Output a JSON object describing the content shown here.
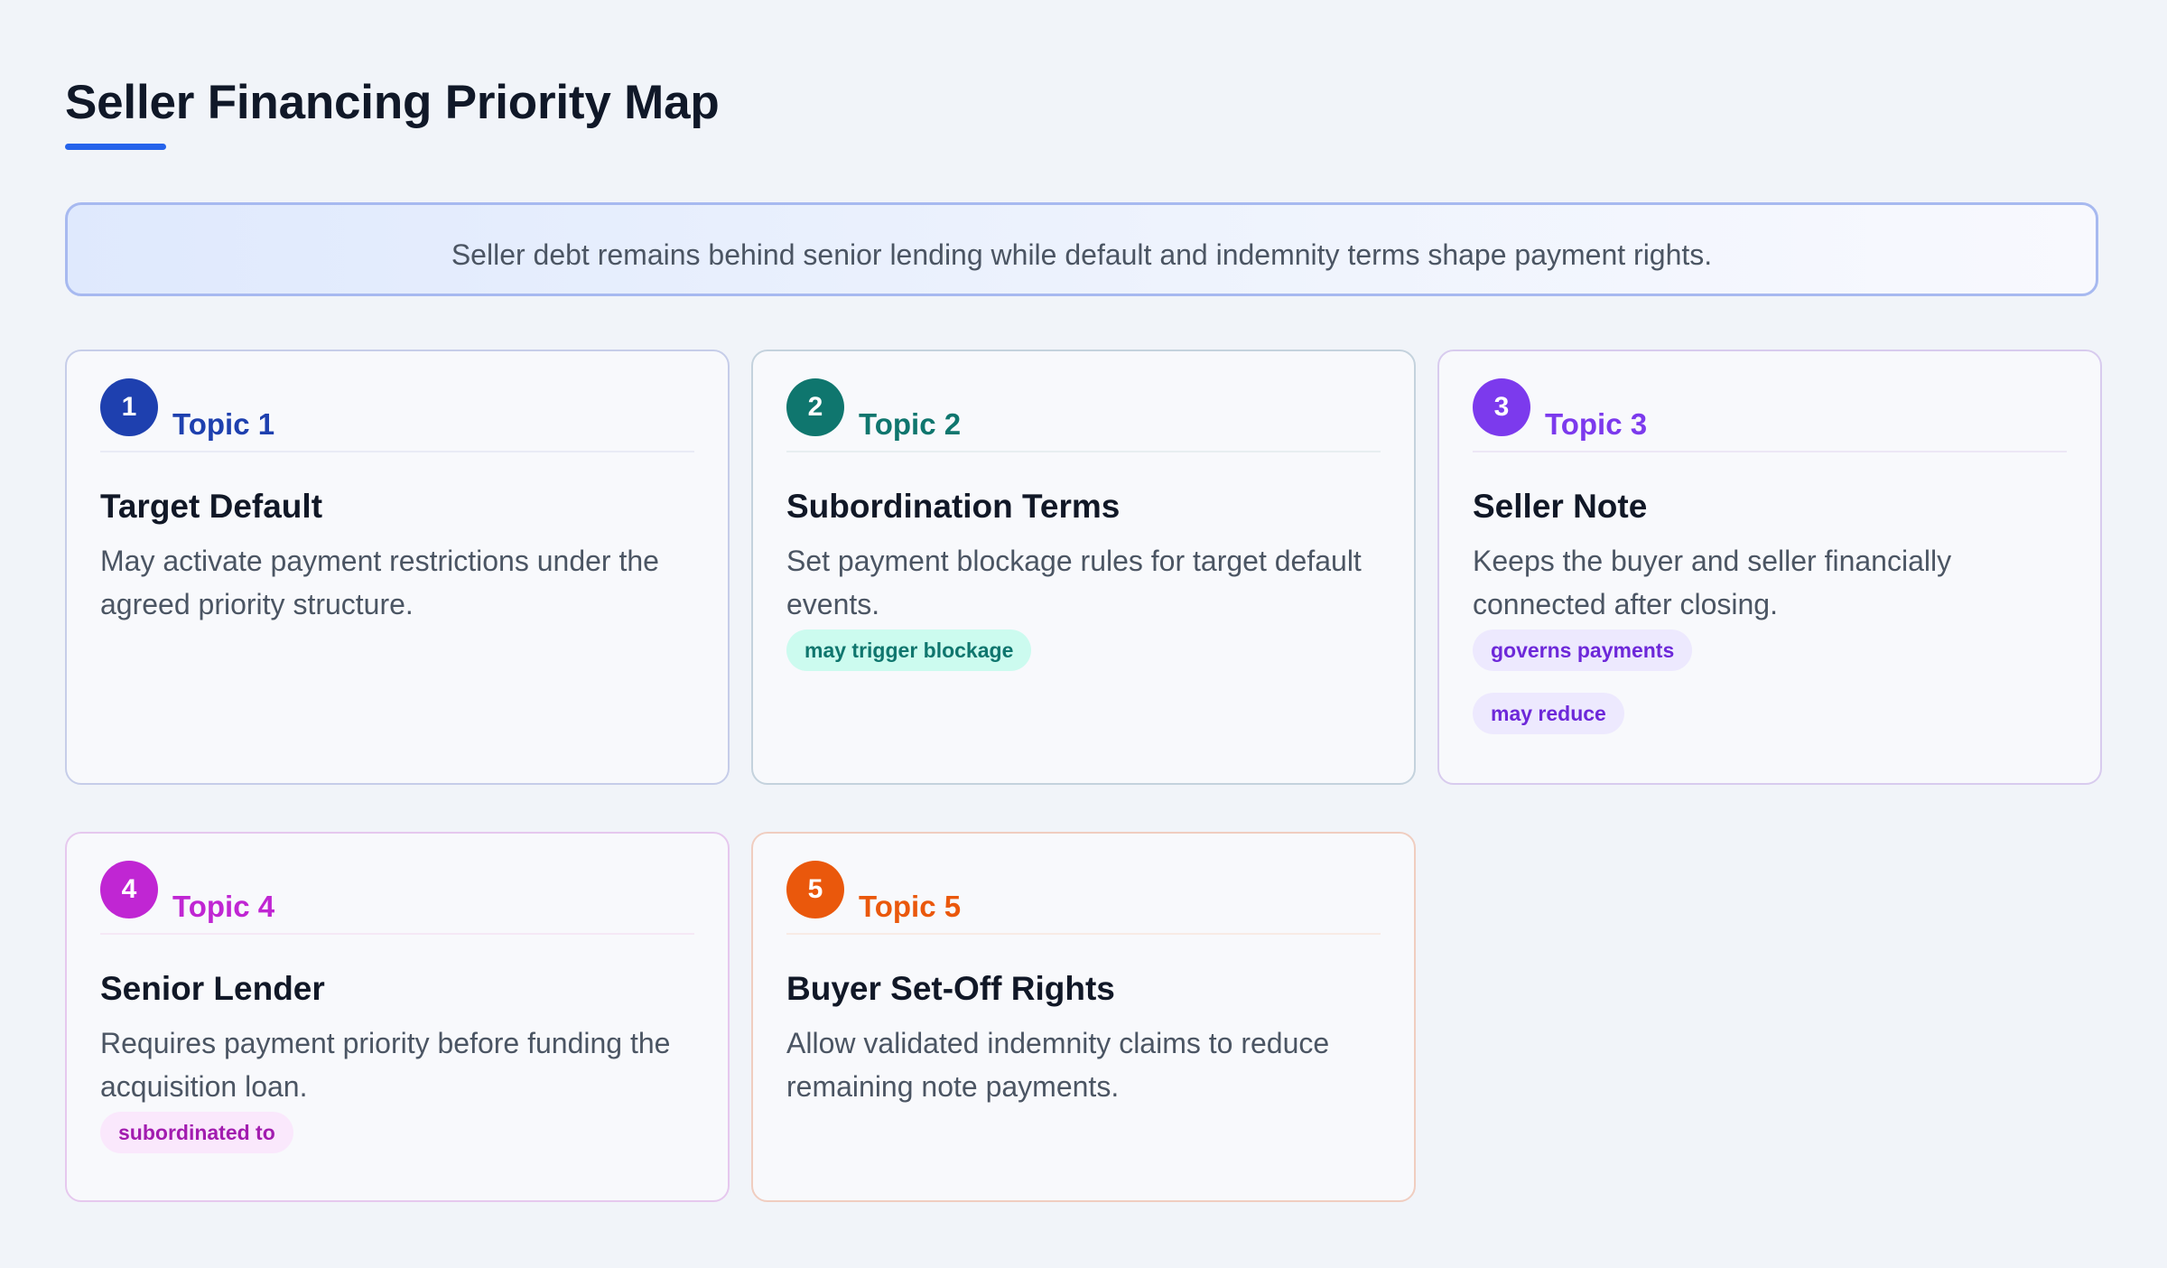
{
  "title": "Seller Financing Priority Map",
  "summary": "Seller debt remains behind senior lending while default and indemnity terms shape payment rights.",
  "colors": {
    "accent": "#2563eb",
    "topic_1": "#1e40af",
    "topic_2": "#0f766e",
    "topic_3": "#7c3aed",
    "topic_4": "#c026d3",
    "topic_5": "#ea580c"
  },
  "cards": [
    {
      "number": "1",
      "topic": "Topic 1",
      "title": "Target Default",
      "description": "May activate payment restrictions under the agreed priority structure.",
      "tags": []
    },
    {
      "number": "2",
      "topic": "Topic 2",
      "title": "Subordination Terms",
      "description": "Set payment blockage rules for target default events.",
      "tags": [
        "may trigger blockage"
      ]
    },
    {
      "number": "3",
      "topic": "Topic 3",
      "title": "Seller Note",
      "description": "Keeps the buyer and seller financially connected after closing.",
      "tags": [
        "governs payments",
        "may reduce"
      ]
    },
    {
      "number": "4",
      "topic": "Topic 4",
      "title": "Senior Lender",
      "description": "Requires payment priority before funding the acquisition loan.",
      "tags": [
        "subordinated to"
      ]
    },
    {
      "number": "5",
      "topic": "Topic 5",
      "title": "Buyer Set-Off Rights",
      "description": "Allow validated indemnity claims to reduce remaining note payments.",
      "tags": []
    }
  ]
}
